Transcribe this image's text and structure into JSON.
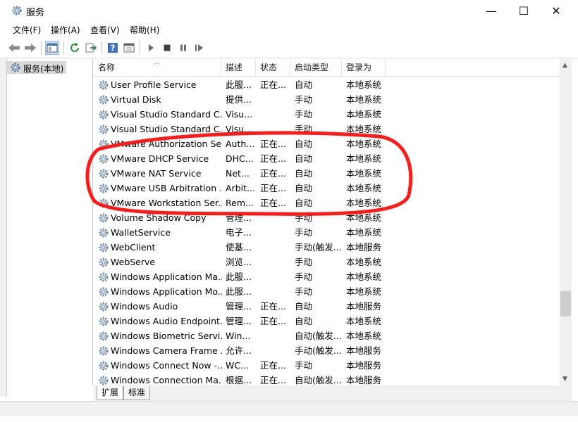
{
  "window": {
    "title": "服务",
    "minimize": "—",
    "maximize": "☐",
    "close": "✕"
  },
  "menu": [
    "文件(F)",
    "操作(A)",
    "查看(V)",
    "帮助(H)"
  ],
  "toolbar_icons": [
    "back-arrow-icon",
    "forward-arrow-icon",
    "console-tree-icon",
    "refresh-icon",
    "export-icon",
    "help-icon",
    "properties-icon",
    "start-service-icon",
    "stop-service-icon",
    "pause-service-icon",
    "resume-service-icon"
  ],
  "tree": {
    "label": "服务(本地)"
  },
  "columns": [
    "名称",
    "描述",
    "状态",
    "启动类型",
    "登录为"
  ],
  "rows": [
    {
      "name": "User Profile Service",
      "desc": "此服...",
      "status": "正在...",
      "startup": "自动",
      "logon": "本地系统"
    },
    {
      "name": "Virtual Disk",
      "desc": "提供...",
      "status": "",
      "startup": "手动",
      "logon": "本地系统"
    },
    {
      "name": "Visual Studio Standard C...",
      "desc": "Visu...",
      "status": "",
      "startup": "手动",
      "logon": "本地系统"
    },
    {
      "name": "Visual Studio Standard C...",
      "desc": "Visu...",
      "status": "",
      "startup": "手动",
      "logon": "本地系统"
    },
    {
      "name": "VMware Authorization Se...",
      "desc": "Auth...",
      "status": "正在...",
      "startup": "自动",
      "logon": "本地系统"
    },
    {
      "name": "VMware DHCP Service",
      "desc": "DHC...",
      "status": "正在...",
      "startup": "自动",
      "logon": "本地系统"
    },
    {
      "name": "VMware NAT Service",
      "desc": "Net...",
      "status": "正在...",
      "startup": "自动",
      "logon": "本地系统"
    },
    {
      "name": "VMware USB Arbitration ...",
      "desc": "Arbit...",
      "status": "正在...",
      "startup": "自动",
      "logon": "本地系统"
    },
    {
      "name": "VMware Workstation Ser...",
      "desc": "Rem...",
      "status": "正在...",
      "startup": "自动",
      "logon": "本地系统"
    },
    {
      "name": "Volume Shadow Copy",
      "desc": "管理...",
      "status": "",
      "startup": "手动",
      "logon": "本地系统"
    },
    {
      "name": "WalletService",
      "desc": "电子...",
      "status": "",
      "startup": "手动",
      "logon": "本地系统"
    },
    {
      "name": "WebClient",
      "desc": "使基...",
      "status": "",
      "startup": "手动(触发...",
      "logon": "本地服务"
    },
    {
      "name": "WebServe",
      "desc": "浏览...",
      "status": "",
      "startup": "手动",
      "logon": "本地系统"
    },
    {
      "name": "Windows Application Ma...",
      "desc": "此服...",
      "status": "",
      "startup": "手动",
      "logon": "本地系统"
    },
    {
      "name": "Windows Application Mo...",
      "desc": "此服...",
      "status": "",
      "startup": "手动",
      "logon": "本地系统"
    },
    {
      "name": "Windows Audio",
      "desc": "管理...",
      "status": "正在...",
      "startup": "自动",
      "logon": "本地服务"
    },
    {
      "name": "Windows Audio Endpoint...",
      "desc": "管理...",
      "status": "正在...",
      "startup": "自动",
      "logon": "本地系统"
    },
    {
      "name": "Windows Biometric Servi...",
      "desc": "Win...",
      "status": "",
      "startup": "自动(触发...",
      "logon": "本地系统"
    },
    {
      "name": "Windows Camera Frame ...",
      "desc": "允许...",
      "status": "",
      "startup": "手动(触发...",
      "logon": "本地服务"
    },
    {
      "name": "Windows Connect Now -...",
      "desc": "WC...",
      "status": "正在...",
      "startup": "手动",
      "logon": "本地服务"
    },
    {
      "name": "Windows Connection Ma...",
      "desc": "根据...",
      "status": "正在...",
      "startup": "自动(触发...",
      "logon": "本地服务"
    }
  ],
  "tabs": [
    "扩展",
    "标准"
  ],
  "colors": {
    "annotation": "#ff1a1a",
    "selection": "#d9d9d9"
  }
}
